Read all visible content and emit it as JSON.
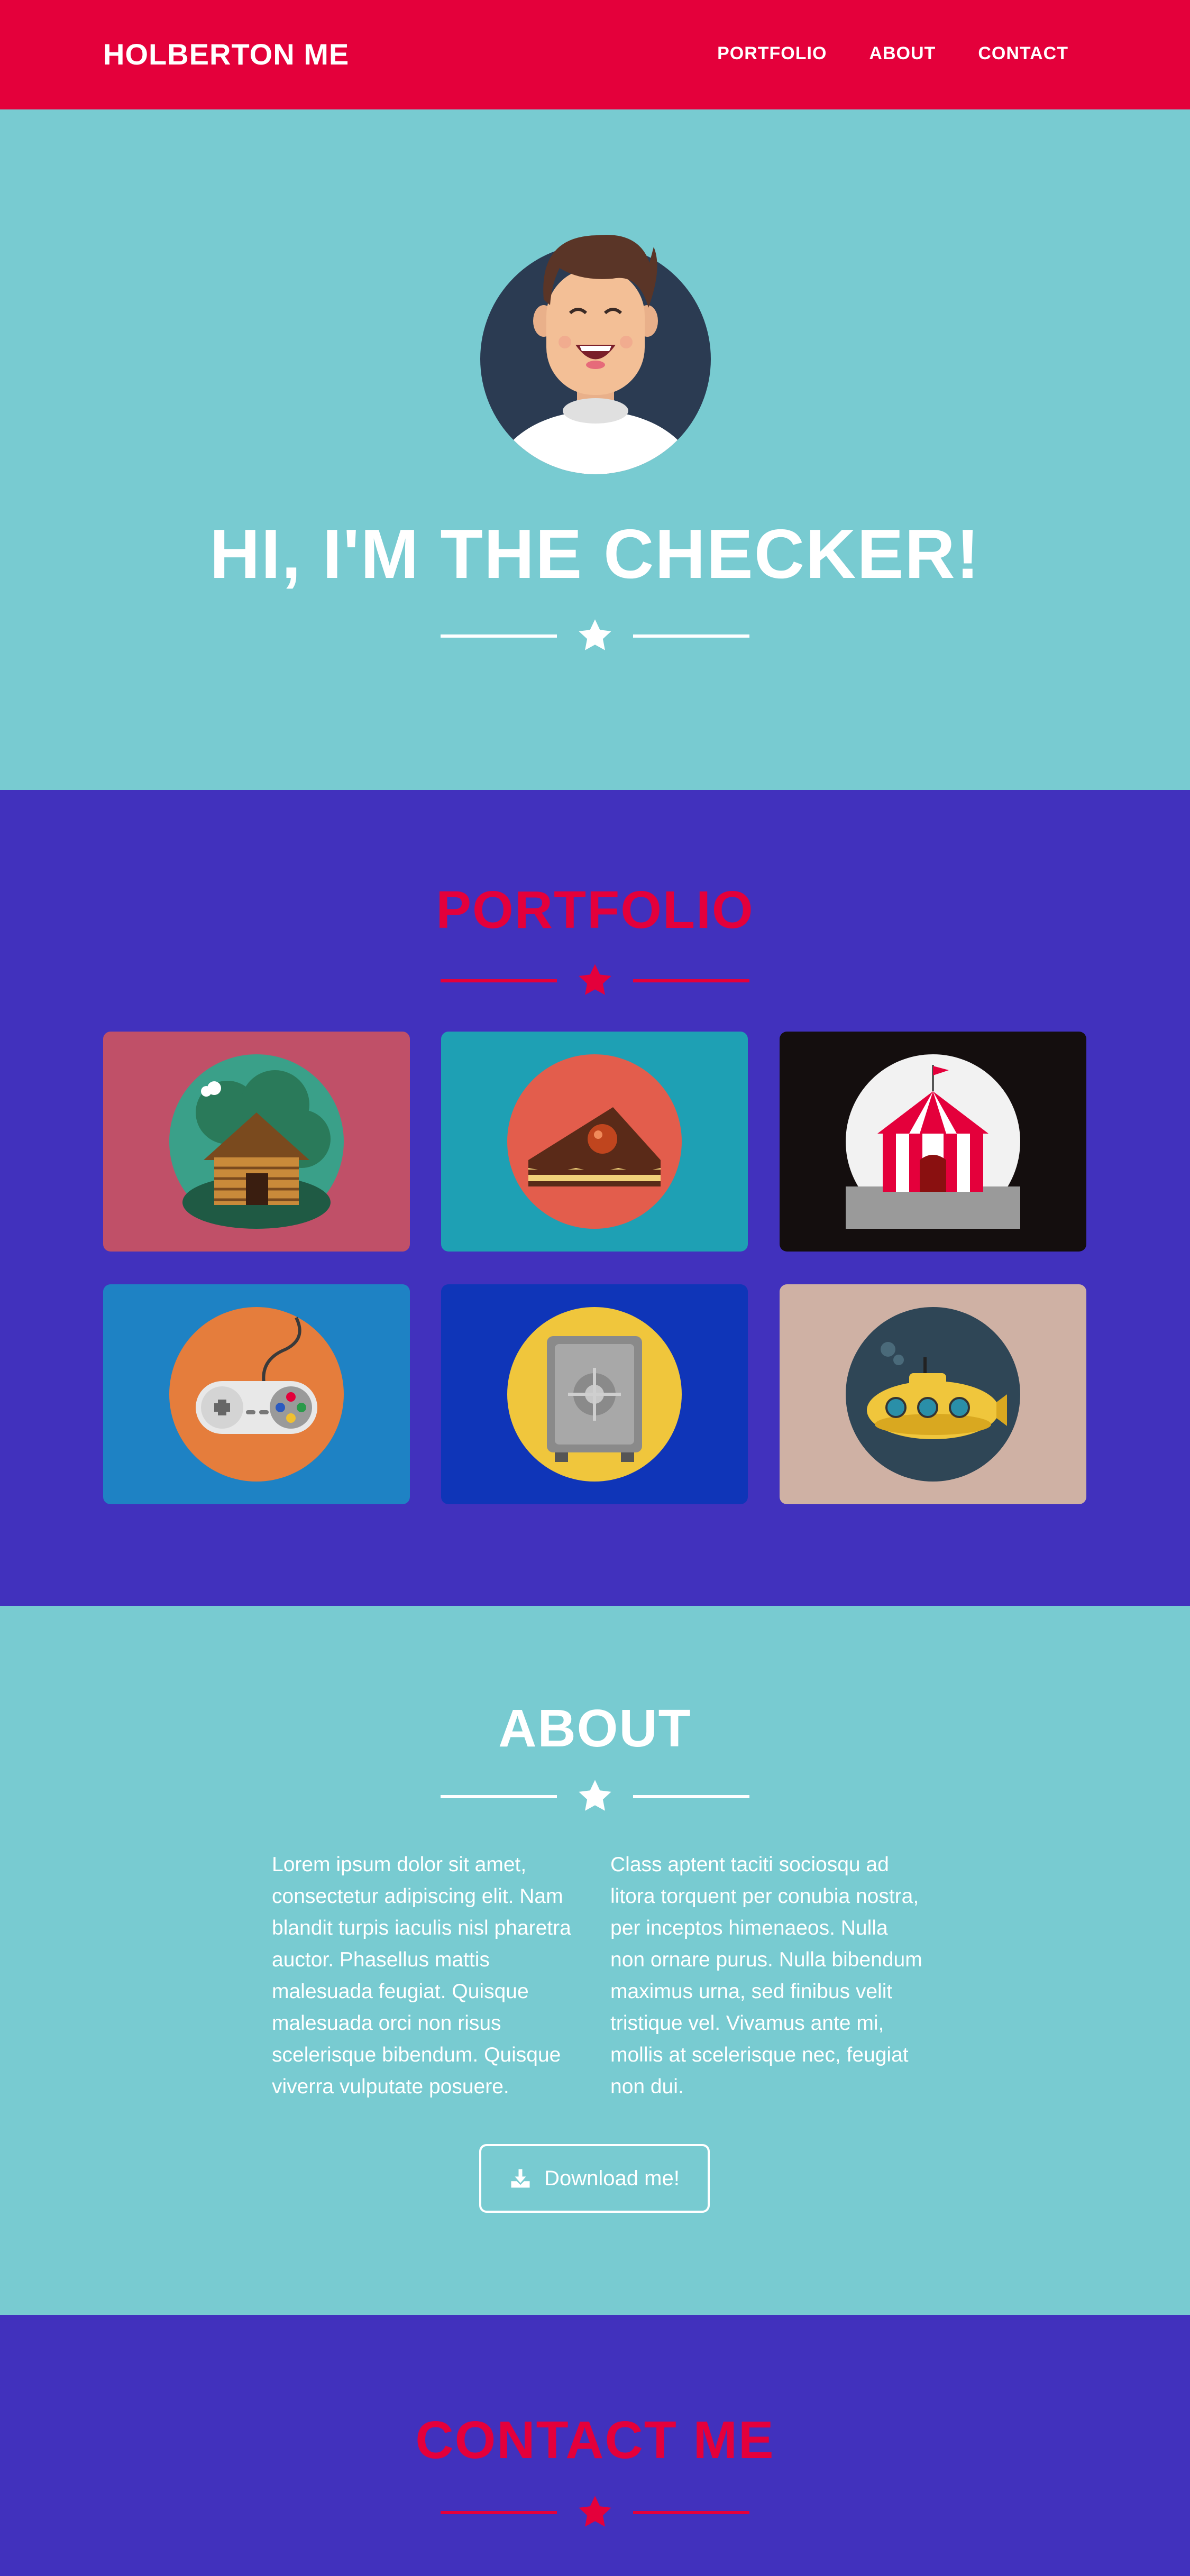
{
  "nav": {
    "brand": "HOLBERTON ME",
    "links": [
      "PORTFOLIO",
      "ABOUT",
      "CONTACT"
    ]
  },
  "hero": {
    "title": "HI, I'M THE CHECKER!"
  },
  "portfolio": {
    "title": "PORTFOLIO",
    "items": [
      {
        "icon": "log-cabin-icon",
        "bg": "#c05068"
      },
      {
        "icon": "cake-slice-icon",
        "bg": "#1ea0b4"
      },
      {
        "icon": "circus-tent-icon",
        "bg": "#140e0e"
      },
      {
        "icon": "game-controller-icon",
        "bg": "#1e82c4"
      },
      {
        "icon": "safe-icon",
        "bg": "#0f35b8"
      },
      {
        "icon": "submarine-icon",
        "bg": "#cfb1a4"
      }
    ]
  },
  "about": {
    "title": "ABOUT",
    "left_text": "Lorem ipsum dolor sit amet, consectetur adipiscing elit. Nam blandit turpis iaculis nisl pharetra auctor. Phasellus mattis malesuada feugiat. Quisque malesuada orci non risus scelerisque bibendum. Quisque viverra vulputate posuere.",
    "right_text": "Class aptent taciti sociosqu ad litora torquent per conubia nostra, per inceptos himenaeos. Nulla non ornare purus. Nulla bibendum maximus urna, sed finibus velit tristique vel. Vivamus ante mi, mollis at scelerisque nec, feugiat non dui.",
    "download_label": "Download me!"
  },
  "contact": {
    "title": "CONTACT ME"
  },
  "colors": {
    "red": "#e4003b",
    "teal": "#78cbd1",
    "purple": "#4131bd",
    "white": "#ffffff"
  }
}
